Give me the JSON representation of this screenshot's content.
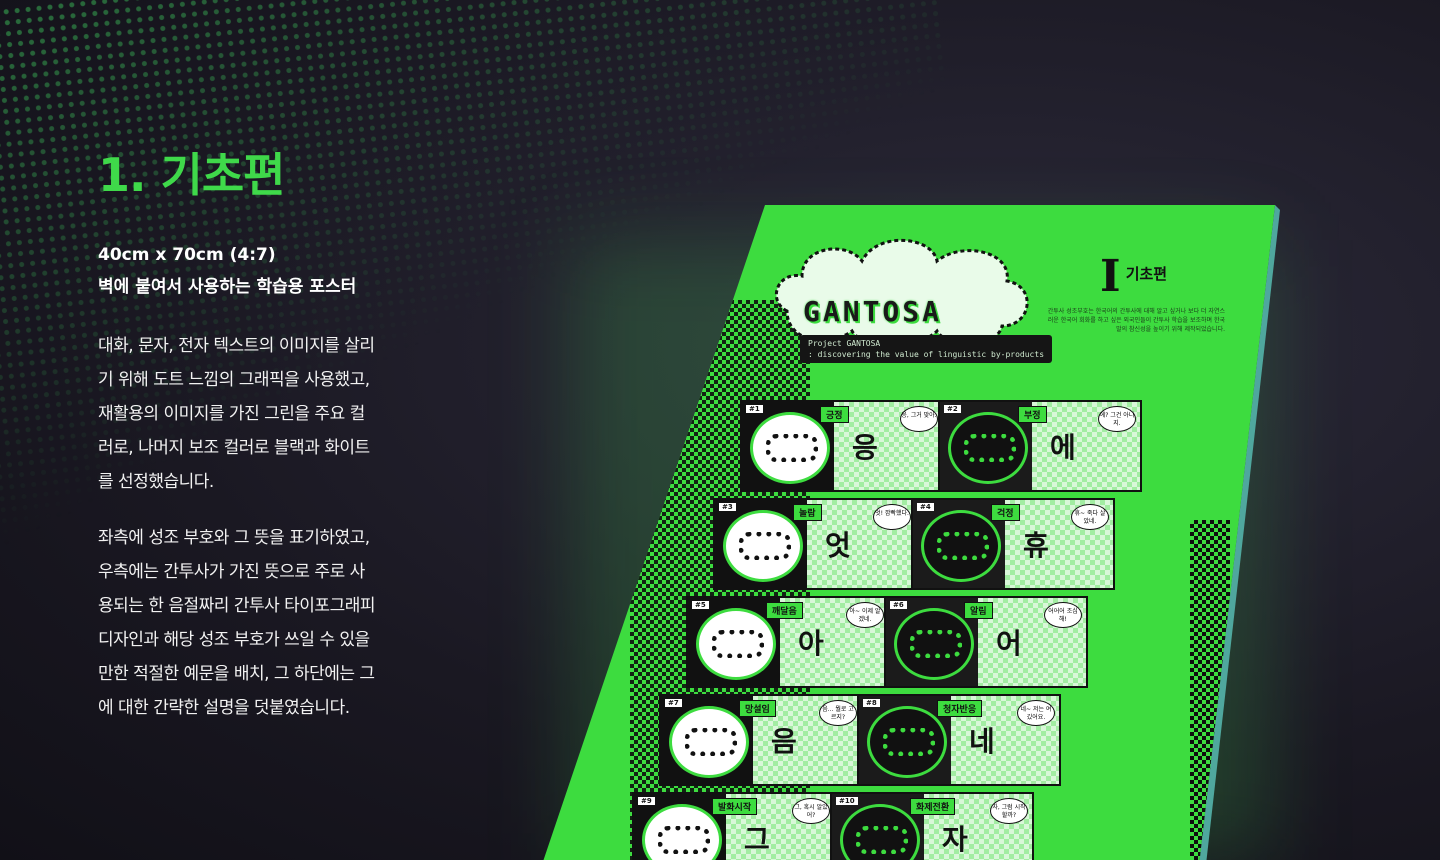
{
  "section": {
    "title": "1. 기초편",
    "spec_size": "40cm x 70cm (4:7)",
    "spec_use": "벽에 붙여서 사용하는 학습용 포스터",
    "paragraph1": "대화, 문자, 전자 텍스트의 이미지를 살리기 위해 도트 느낌의 그래픽을 사용했고, 재활용의 이미지를 가진 그린을 주요 컬러로, 나머지 보조 컬러로 블랙과 화이트를 선정했습니다.",
    "paragraph2": "좌측에 성조 부호와 그 뜻을 표기하였고, 우측에는 간투사가 가진 뜻으로 주로 사용되는 한 음절짜리 간투사 타이포그래피 디자인과 해당 성조 부호가 쓰일 수 있을 만한 적절한 예문을 배치, 그 하단에는 그에 대한 간략한 설명을 덧붙였습니다."
  },
  "poster": {
    "logo": "GANTOSA",
    "project_line1": "Project GANTOSA",
    "project_line2": ": discovering the value of linguistic by-products",
    "chapter_num": "I",
    "chapter_title": "기초편",
    "intro": "간투사 성조부호는 한국어의 간투사에 대해 알고 싶거나 보다 더 자연스러운 한국어 회화를 하고 싶은 외국인들이 간투사 학습을 보조하며 한국말의 참신성을 높이기 위해 제작되었습니다.",
    "cards": [
      {
        "num": "#1",
        "tag": "긍정",
        "word": "응",
        "bubble": "응, 그거 맞아."
      },
      {
        "num": "#2",
        "tag": "부정",
        "word": "에",
        "bubble": "에? 그건 아니지."
      },
      {
        "num": "#3",
        "tag": "놀람",
        "word": "엇",
        "bubble": "엇! 깜빡했다."
      },
      {
        "num": "#4",
        "tag": "걱정",
        "word": "휴",
        "bubble": "휴~ 죽다 살았네."
      },
      {
        "num": "#5",
        "tag": "깨달음",
        "word": "아",
        "bubble": "아~ 이제 알겠네."
      },
      {
        "num": "#6",
        "tag": "알림",
        "word": "어",
        "bubble": "어어어 조심해!"
      },
      {
        "num": "#7",
        "tag": "망설임",
        "word": "음",
        "bubble": "음... 뭘로 고르지?"
      },
      {
        "num": "#8",
        "tag": "청자반응",
        "word": "네",
        "bubble": "네~ 저는 여깄어요."
      },
      {
        "num": "#9",
        "tag": "발화시작",
        "word": "그",
        "bubble": "그, 혹시 알았어?"
      },
      {
        "num": "#10",
        "tag": "화제전환",
        "word": "자",
        "bubble": "자, 그럼 시작할까?"
      }
    ]
  },
  "colors": {
    "accent_green": "#3fd94a",
    "poster_green": "#3ddc3f",
    "background": "#1b1a24"
  }
}
